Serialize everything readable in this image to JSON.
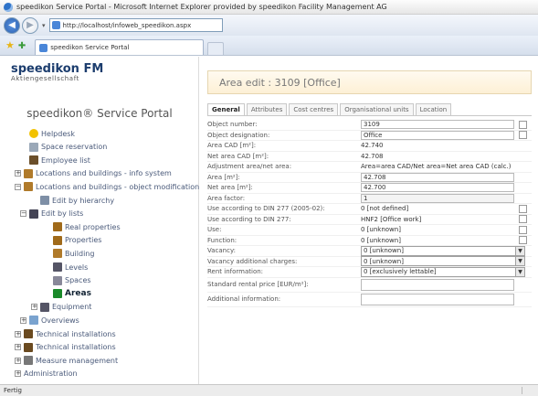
{
  "browser": {
    "title": "speedikon Service Portal - Microsoft Internet Explorer provided by speedikon Facility Management AG",
    "url": "http://localhost/infoweb_speedikon.aspx",
    "tab_title": "speedikon Service Portal",
    "status": "Fertig"
  },
  "brand": {
    "name": "speedikon FM",
    "subtitle": "Aktiengesellschaft",
    "portal_title": "speedikon® Service Portal"
  },
  "nav": [
    {
      "label": "Helpdesk",
      "icon": "smiley-icon",
      "level": 1,
      "expander": ""
    },
    {
      "label": "Space reservation",
      "icon": "calendar-icon",
      "level": 1,
      "expander": ""
    },
    {
      "label": "Employee list",
      "icon": "person-icon",
      "level": 1,
      "expander": ""
    },
    {
      "label": "Locations and buildings - info system",
      "icon": "building-icon",
      "level": 0,
      "expander": "+"
    },
    {
      "label": "Locations and buildings - object modification",
      "icon": "building-icon",
      "level": 0,
      "expander": "−"
    },
    {
      "label": "Edit by hierarchy",
      "icon": "hierarchy-icon",
      "level": 2,
      "expander": ""
    },
    {
      "label": "Edit by lists",
      "icon": "list-icon",
      "level": 1,
      "expander": "−"
    },
    {
      "label": "Real properties",
      "icon": "property-icon",
      "level": 3,
      "expander": ""
    },
    {
      "label": "Properties",
      "icon": "property-icon",
      "level": 3,
      "expander": ""
    },
    {
      "label": "Building",
      "icon": "building-icon",
      "level": 3,
      "expander": ""
    },
    {
      "label": "Levels",
      "icon": "levels-icon",
      "level": 3,
      "expander": ""
    },
    {
      "label": "Spaces",
      "icon": "space-icon",
      "level": 3,
      "expander": ""
    },
    {
      "label": "Areas",
      "icon": "area-icon",
      "level": 3,
      "expander": "",
      "active": true
    },
    {
      "label": "Equipment",
      "icon": "equipment-icon",
      "level": 2,
      "expander": "+"
    },
    {
      "label": "Overviews",
      "icon": "overview-icon",
      "level": 1,
      "expander": "+"
    },
    {
      "label": "Technical installations",
      "icon": "tech-icon",
      "level": 0,
      "expander": "+"
    },
    {
      "label": "Technical installations",
      "icon": "tech-icon",
      "level": 0,
      "expander": "+"
    },
    {
      "label": "Measure management",
      "icon": "measure-icon",
      "level": 0,
      "expander": "+"
    },
    {
      "label": "Administration",
      "icon": "",
      "level": 0,
      "expander": "+"
    }
  ],
  "page": {
    "header": "Area edit : 3109 [Office]",
    "tabs": [
      "General",
      "Attributes",
      "Cost centres",
      "Organisational units",
      "Location"
    ],
    "active_tab": "General"
  },
  "form": [
    {
      "label": "Object number:",
      "value": "3109",
      "kind": "input",
      "check": true
    },
    {
      "label": "Object designation:",
      "value": "Office",
      "kind": "input",
      "check": true
    },
    {
      "label": "Area CAD [m²]:",
      "value": "42.740",
      "kind": "text",
      "check": false
    },
    {
      "label": "Net area CAD [m²]:",
      "value": "42.708",
      "kind": "text",
      "check": false
    },
    {
      "label": "Adjustment area/net area:",
      "value": "Area=area CAD/Net area=Net area CAD (calc.)",
      "kind": "text",
      "check": false
    },
    {
      "label": "Area [m²]:",
      "value": "42.708",
      "kind": "input",
      "check": false
    },
    {
      "label": "Net area [m²]:",
      "value": "42.700",
      "kind": "input",
      "check": false
    },
    {
      "label": "Area factor:",
      "value": "1",
      "kind": "input",
      "check": false
    },
    {
      "label": "Use according to DIN 277 (2005-02):",
      "value": "0 [not defined]",
      "kind": "text",
      "check": true
    },
    {
      "label": "Use according to DIN 277:",
      "value": "HNF2 [Office work]",
      "kind": "text",
      "check": true
    },
    {
      "label": "Use:",
      "value": "0 [unknown]",
      "kind": "text",
      "check": true
    },
    {
      "label": "Function:",
      "value": "0 [unknown]",
      "kind": "text",
      "check": true
    },
    {
      "label": "Vacancy:",
      "value": "0 [unknown]",
      "kind": "select",
      "check": false
    },
    {
      "label": "Vacancy additional charges:",
      "value": "0 [unknown]",
      "kind": "select",
      "check": false
    },
    {
      "label": "Rent information:",
      "value": "0 [exclusively lettable]",
      "kind": "select",
      "check": false
    },
    {
      "label": "Standard rental price [EUR/m²]:",
      "value": "",
      "kind": "input",
      "check": false
    },
    {
      "label": "Additional information:",
      "value": "",
      "kind": "input",
      "check": false
    }
  ]
}
